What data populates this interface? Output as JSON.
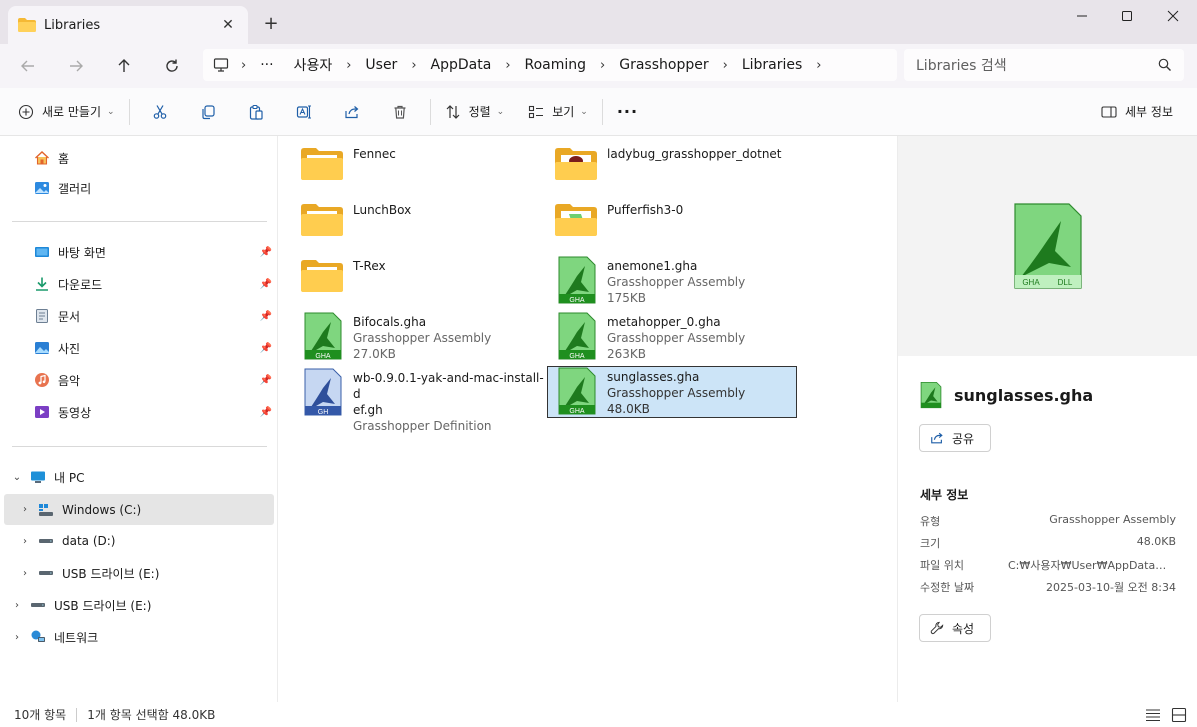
{
  "window": {
    "tab_title": "Libraries",
    "new_tab_glyph": "+",
    "close_tab_glyph": "✕"
  },
  "address": {
    "crumbs": [
      "사용자",
      "User",
      "AppData",
      "Roaming",
      "Grasshopper",
      "Libraries"
    ],
    "ellipsis": "···",
    "search_placeholder": "Libraries 검색"
  },
  "commands": {
    "new": "새로 만들기",
    "sort": "정렬",
    "view": "보기",
    "more": "···",
    "details": "세부 정보"
  },
  "sidebar": {
    "home": "홈",
    "gallery": "갤러리",
    "quick": [
      "바탕 화면",
      "다운로드",
      "문서",
      "사진",
      "음악",
      "동영상"
    ],
    "this_pc": "내 PC",
    "drives": [
      "Windows (C:)",
      "data (D:)",
      "USB 드라이브 (E:)"
    ],
    "usb": "USB 드라이브 (E:)",
    "network": "네트워크"
  },
  "files": [
    {
      "name": "Fennec",
      "type": "",
      "size": "",
      "kind": "folder"
    },
    {
      "name": "ladybug_grasshopper_dotnet",
      "type": "",
      "size": "",
      "kind": "folder"
    },
    {
      "name": "LunchBox",
      "type": "",
      "size": "",
      "kind": "folder"
    },
    {
      "name": "Pufferfish3-0",
      "type": "",
      "size": "",
      "kind": "folder"
    },
    {
      "name": "T-Rex",
      "type": "",
      "size": "",
      "kind": "folder"
    },
    {
      "name": "anemone1.gha",
      "type": "Grasshopper Assembly",
      "size": "175KB",
      "kind": "gha"
    },
    {
      "name": "Bifocals.gha",
      "type": "Grasshopper Assembly",
      "size": "27.0KB",
      "kind": "gha"
    },
    {
      "name": "metahopper_0.gha",
      "type": "Grasshopper Assembly",
      "size": "263KB",
      "kind": "gha"
    },
    {
      "name": "wb-0.9.0.1-yak-and-mac-install-def.gh",
      "name_line1": "wb-0.9.0.1-yak-and-mac-install-d",
      "name_line2": "ef.gh",
      "type": "Grasshopper Definition",
      "size": "",
      "kind": "gh"
    },
    {
      "name": "sunglasses.gha",
      "type": "Grasshopper Assembly",
      "size": "48.0KB",
      "kind": "gha"
    }
  ],
  "details": {
    "name": "sunglasses.gha",
    "share": "공유",
    "heading": "세부 정보",
    "props": [
      {
        "k": "유형",
        "v": "Grasshopper Assembly"
      },
      {
        "k": "크기",
        "v": "48.0KB"
      },
      {
        "k": "파일 위치",
        "v": "C:₩사용자₩User₩AppData₩Roaming₩Grasshopper₩Libraries"
      },
      {
        "k": "수정한 날짜",
        "v": "2025-03-10-월 오전 8:34"
      }
    ],
    "properties": "속성"
  },
  "status": {
    "count": "10개 항목",
    "selection": "1개 항목 선택함 48.0KB"
  },
  "colors": {
    "accent": "#0067c0",
    "selection": "#cce4f7",
    "folder": "#f8c94a",
    "gha_green": "#2ea043"
  }
}
